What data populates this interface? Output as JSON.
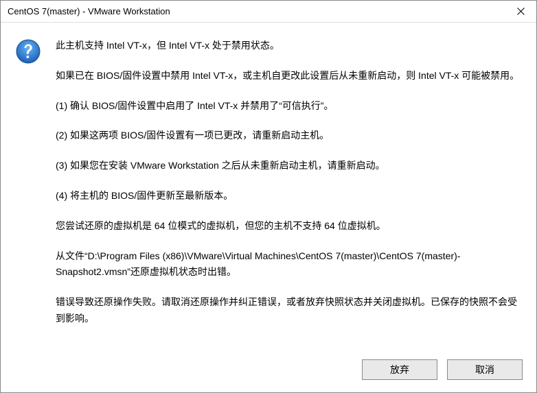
{
  "window": {
    "title": "CentOS 7(master) - VMware Workstation"
  },
  "message": {
    "p1": "此主机支持 Intel VT-x，但 Intel VT-x 处于禁用状态。",
    "p2": "如果已在 BIOS/固件设置中禁用 Intel VT-x，或主机自更改此设置后从未重新启动，则 Intel VT-x 可能被禁用。",
    "p3": "(1) 确认 BIOS/固件设置中启用了 Intel VT-x 并禁用了“可信执行”。",
    "p4": "(2) 如果这两项 BIOS/固件设置有一项已更改，请重新启动主机。",
    "p5": "(3) 如果您在安装 VMware Workstation 之后从未重新启动主机，请重新启动。",
    "p6": "(4) 将主机的 BIOS/固件更新至最新版本。",
    "p7": "您尝试还原的虚拟机是 64 位模式的虚拟机，但您的主机不支持 64 位虚拟机。",
    "p8": "从文件“D:\\Program Files (x86)\\VMware\\Virtual Machines\\CentOS 7(master)\\CentOS 7(master)-Snapshot2.vmsn”还原虚拟机状态时出错。",
    "p9": "错误导致还原操作失败。请取消还原操作并纠正错误，或者放弃快照状态并关闭虚拟机。已保存的快照不会受到影响。"
  },
  "buttons": {
    "abandon": "放弃",
    "cancel": "取消"
  }
}
